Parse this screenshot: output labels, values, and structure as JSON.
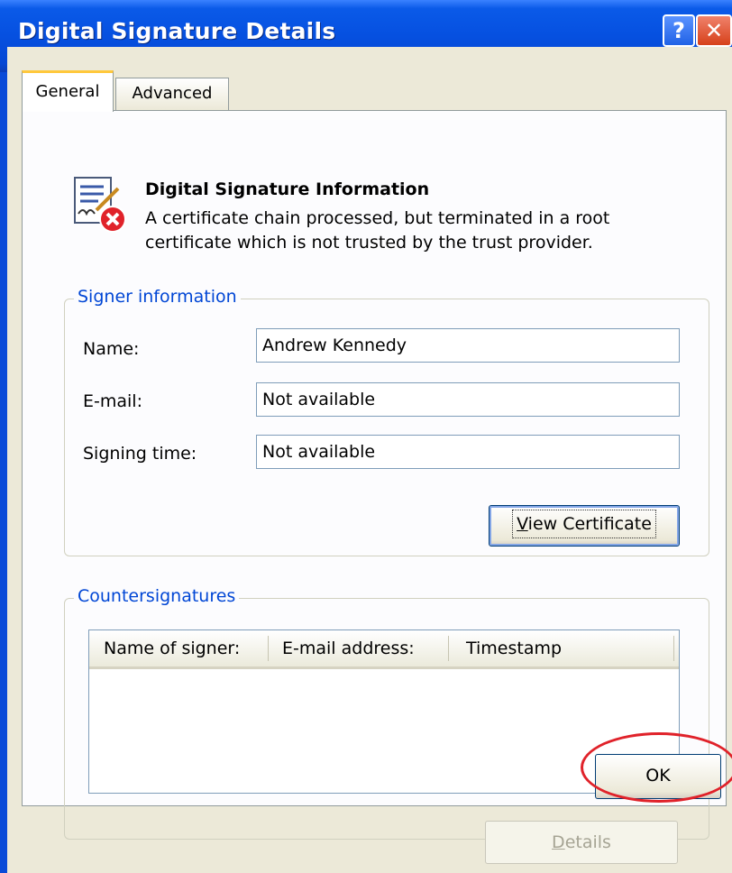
{
  "window": {
    "title": "Digital Signature Details",
    "help_glyph": "?",
    "close_glyph": "✕"
  },
  "tabs": [
    {
      "label": "General",
      "active": true
    },
    {
      "label": "Advanced",
      "active": false
    }
  ],
  "info": {
    "title": "Digital Signature Information",
    "line1": "A certificate chain processed, but terminated in a root",
    "line2": "certificate which is not trusted by the trust provider.",
    "icon": "certificate-error-icon"
  },
  "signer": {
    "legend": "Signer information",
    "name_label": "Name:",
    "name_value": "Andrew Kennedy",
    "email_label": "E-mail:",
    "email_value": "Not available",
    "time_label": "Signing time:",
    "time_value": "Not available",
    "view_button_prefix": "V",
    "view_button_rest": "iew Certificate"
  },
  "counter": {
    "legend": "Countersignatures",
    "columns": [
      "Name of signer:",
      "E-mail address:",
      "Timestamp"
    ],
    "rows": [],
    "details_prefix": "D",
    "details_rest": "etails"
  },
  "footer": {
    "ok_label": "OK"
  },
  "colors": {
    "title_bar": "#0650e0",
    "legend_text": "#0046d5",
    "highlight_circle": "#e0222a",
    "tab_accent": "#ffc83c"
  }
}
